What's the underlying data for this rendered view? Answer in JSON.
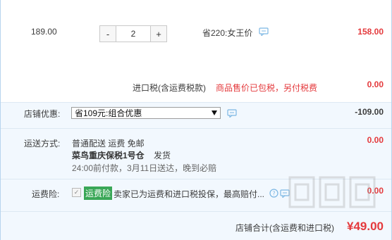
{
  "item": {
    "unit_price": "189.00",
    "quantity": "2",
    "decrement_label": "-",
    "increment_label": "+",
    "promo_text": "省220:女王价",
    "total": "158.00"
  },
  "tax": {
    "label": "进口税(含运费税款)",
    "note": "商品售价已包税，另付税费",
    "value": "0.00"
  },
  "shop_promo": {
    "label": "店铺优惠:",
    "selected": "省109元:组合优惠",
    "value": "-109.00"
  },
  "shipping": {
    "label": "运送方式:",
    "line1": "普通配送  运费 免邮",
    "warehouse": "菜鸟重庆保税1号仓",
    "dispatch": "发货",
    "line3": "24:00前付款，3月11日送达，晚到必赔",
    "value": "0.00"
  },
  "insurance": {
    "label": "运费险:",
    "badge": "运费险",
    "desc": "卖家已为运费和进口税投保，最高赔付...",
    "value": "0.00"
  },
  "summary": {
    "label": "店铺合计(含运费和进口税)",
    "value": "¥49.00"
  },
  "colors": {
    "accent_red": "#e4393c",
    "badge_green": "#3aa757",
    "panel_blue": "#f2f8fe"
  },
  "icons": [
    "chat-bubble-icon",
    "chat-bubble-icon",
    "check-icon",
    "help-icon",
    "chat-bubble-icon"
  ]
}
